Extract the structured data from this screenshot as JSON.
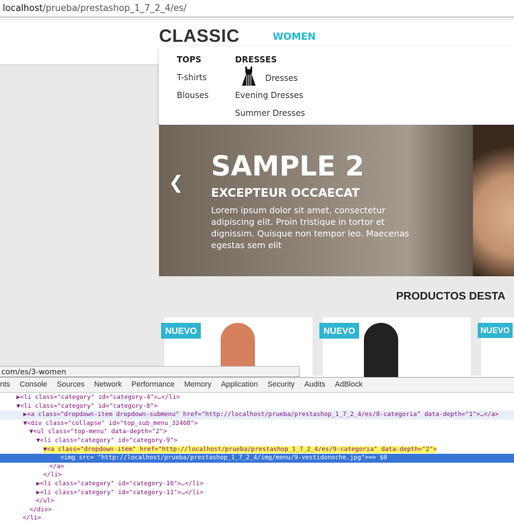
{
  "browser": {
    "url_host": "localhost",
    "url_path": "/prueba/prestashop_1_7_2_4/es/"
  },
  "site": {
    "logo": "CLASSIC",
    "nav_item": "WOMEN",
    "dropdown": {
      "columns": [
        {
          "heading": "TOPS",
          "items": [
            "T-shirts",
            "Blouses"
          ]
        },
        {
          "heading": "DRESSES",
          "items": [
            "Dresses",
            "Evening Dresses",
            "Summer Dresses"
          ],
          "icon": "dress-icon"
        }
      ]
    },
    "hero": {
      "title": "SAMPLE 2",
      "subtitle": "EXCEPTEUR OCCAECAT",
      "text": "Lorem ipsum dolor sit amet, consectetur adipiscing elit. Proin tristique in tortor et dignissim. Quisque non tempor leo. Maecenas egestas sem elit"
    },
    "featured_heading": "PRODUCTOS DESTA",
    "badge": "NUEVO"
  },
  "status_bar": "com/es/3-women",
  "devtools": {
    "tabs": [
      "nts",
      "Console",
      "Sources",
      "Network",
      "Performance",
      "Memory",
      "Application",
      "Security",
      "Audits",
      "AdBlock"
    ],
    "lines": [
      "▶<li class=\"category\" id=\"category-4\">…</li>",
      "▼<li class=\"category\" id=\"category-8\">",
      "▶<a class=\"dropdown-item dropdown-submenu\" href=\"http://localhost/prueba/prestashop_1_7_2_4/es/8-categoria\" data-depth=\"1\">…</a>",
      "▼<div class=\"collapse\" id=\"top_sub_menu_32468\">",
      "▼<ul class=\"top-menu\" data-depth=\"2\">",
      "▼<li class=\"category\" id=\"category-9\">",
      "▼<a class=\"dropdown-item\" href=\"http://localhost/prueba/prestashop_1_7_2_4/es/9-categoria\" data-depth=\"2\">",
      "<img src= \"http://localhost/prueba/prestashop_1_7_2_4/img/menu/9-vestidonoche.jpg\">== $0",
      "</a>",
      "</li>",
      "▶<li class=\"category\" id=\"category-10\">…</li>",
      "▶<li class=\"category\" id=\"category-11\">…</li>",
      "</ul>",
      "</div>",
      "</li>"
    ]
  }
}
